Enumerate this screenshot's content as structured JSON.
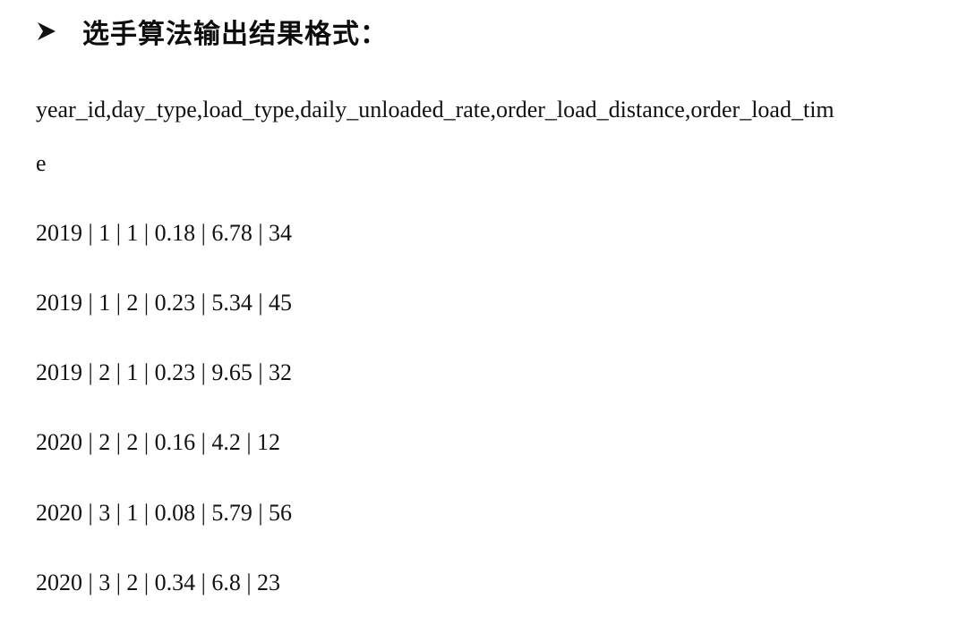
{
  "heading": {
    "text": "选手算法输出结果格式："
  },
  "header": {
    "line1": "year_id,day_type,load_type,daily_unloaded_rate,order_load_distance,order_load_tim",
    "line2": "e"
  },
  "rows": [
    "2019 | 1 | 1 | 0.18 | 6.78 | 34",
    "2019 | 1 | 2 | 0.23 | 5.34 | 45",
    "2019 | 2 | 1 | 0.23 | 9.65 | 32",
    "2020 | 2 | 2 | 0.16 | 4.2 | 12",
    "2020 | 3 | 1 | 0.08 | 5.79 | 56",
    "2020 | 3 | 2 | 0.34 | 6.8 | 23"
  ]
}
